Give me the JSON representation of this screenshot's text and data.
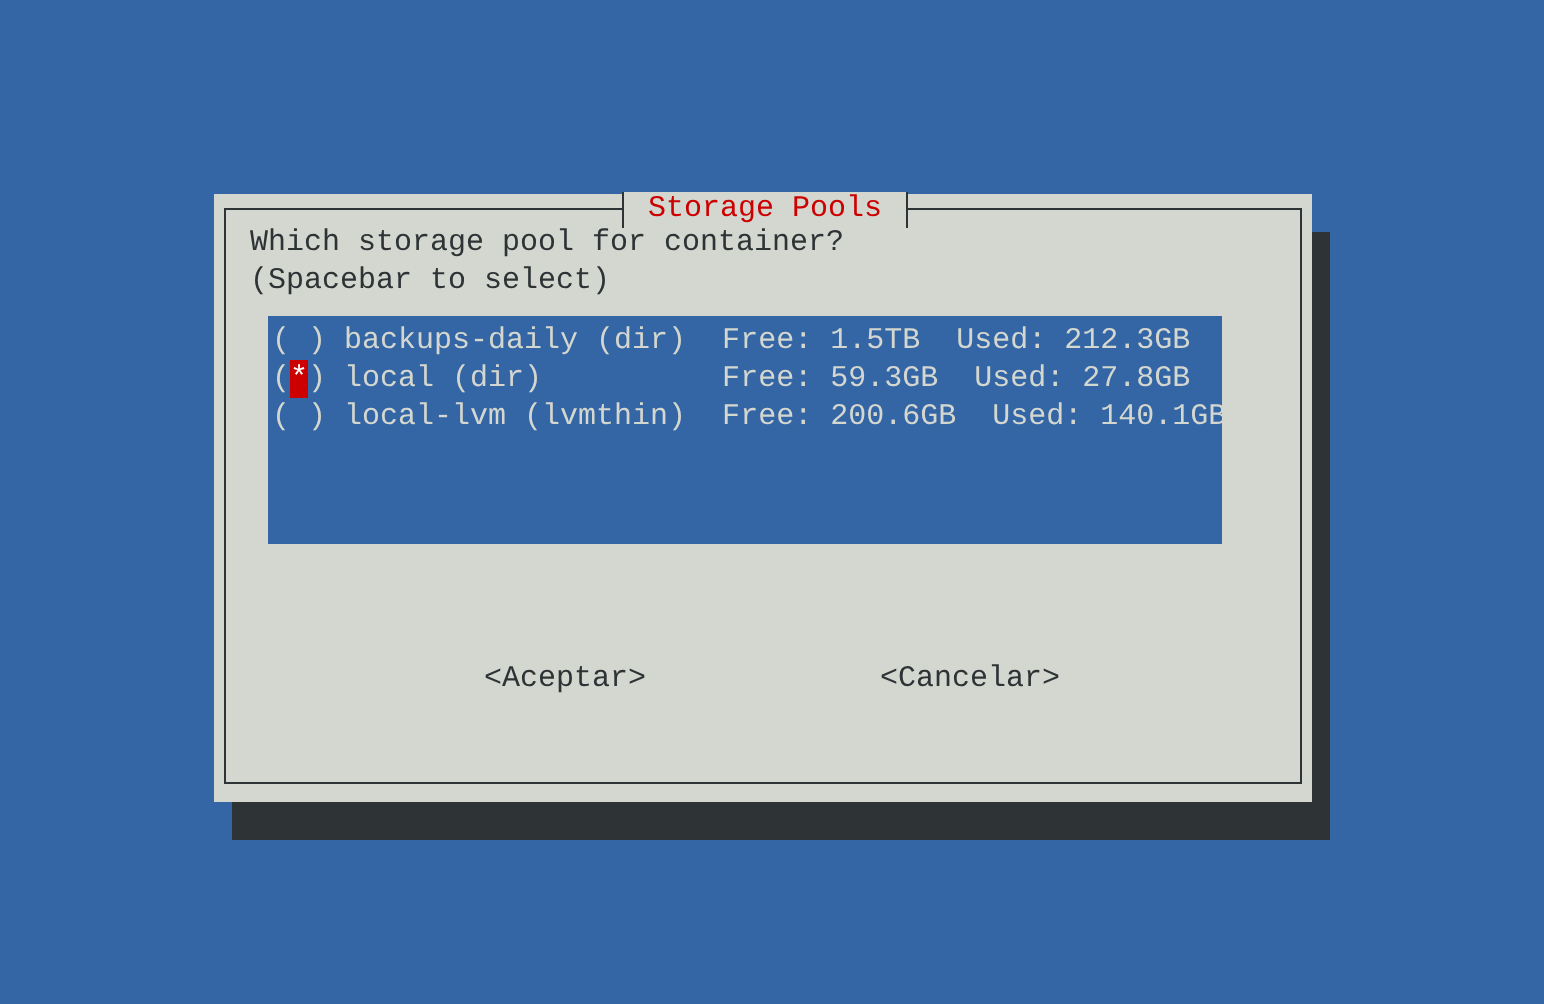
{
  "dialog": {
    "title": "Storage Pools",
    "prompt": [
      "Which storage pool for container?",
      "(Spacebar to select)"
    ]
  },
  "list": {
    "open": "(",
    "close": ")",
    "mark": "*",
    "items": [
      {
        "text": "backups-daily (dir)  Free: 1.5TB  Used: 212.3GB",
        "selected": false
      },
      {
        "text": "local (dir)          Free: 59.3GB  Used: 27.8GB",
        "selected": true
      },
      {
        "text": "local-lvm (lvmthin)  Free: 200.6GB  Used: 140.1GB",
        "selected": false
      }
    ]
  },
  "buttons": [
    "<Aceptar>",
    "<Cancelar>"
  ]
}
